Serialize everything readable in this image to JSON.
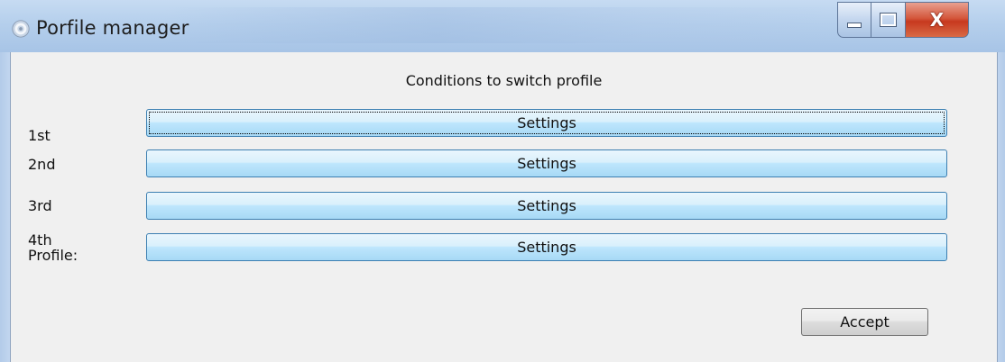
{
  "window": {
    "title": "Porfile manager",
    "controls": {
      "minimize_icon": "minimize-icon",
      "maximize_icon": "maximize-icon",
      "close_icon": "close-icon",
      "close_glyph": "X"
    }
  },
  "content": {
    "heading": "Conditions to switch profile",
    "rows": [
      {
        "label": "1st",
        "button": "Settings"
      },
      {
        "label": "2nd",
        "button": "Settings"
      },
      {
        "label": "3rd",
        "button": "Settings"
      },
      {
        "label": "4th",
        "label_line2": "Profile:",
        "button": "Settings"
      }
    ],
    "accept_button": "Accept"
  },
  "colors": {
    "client_bg": "#f0f0f0",
    "title_bar": "#b5cfec",
    "button_blue": "#bee6fd",
    "button_border": "#3c7fb1",
    "close_red": "#c7391f"
  }
}
